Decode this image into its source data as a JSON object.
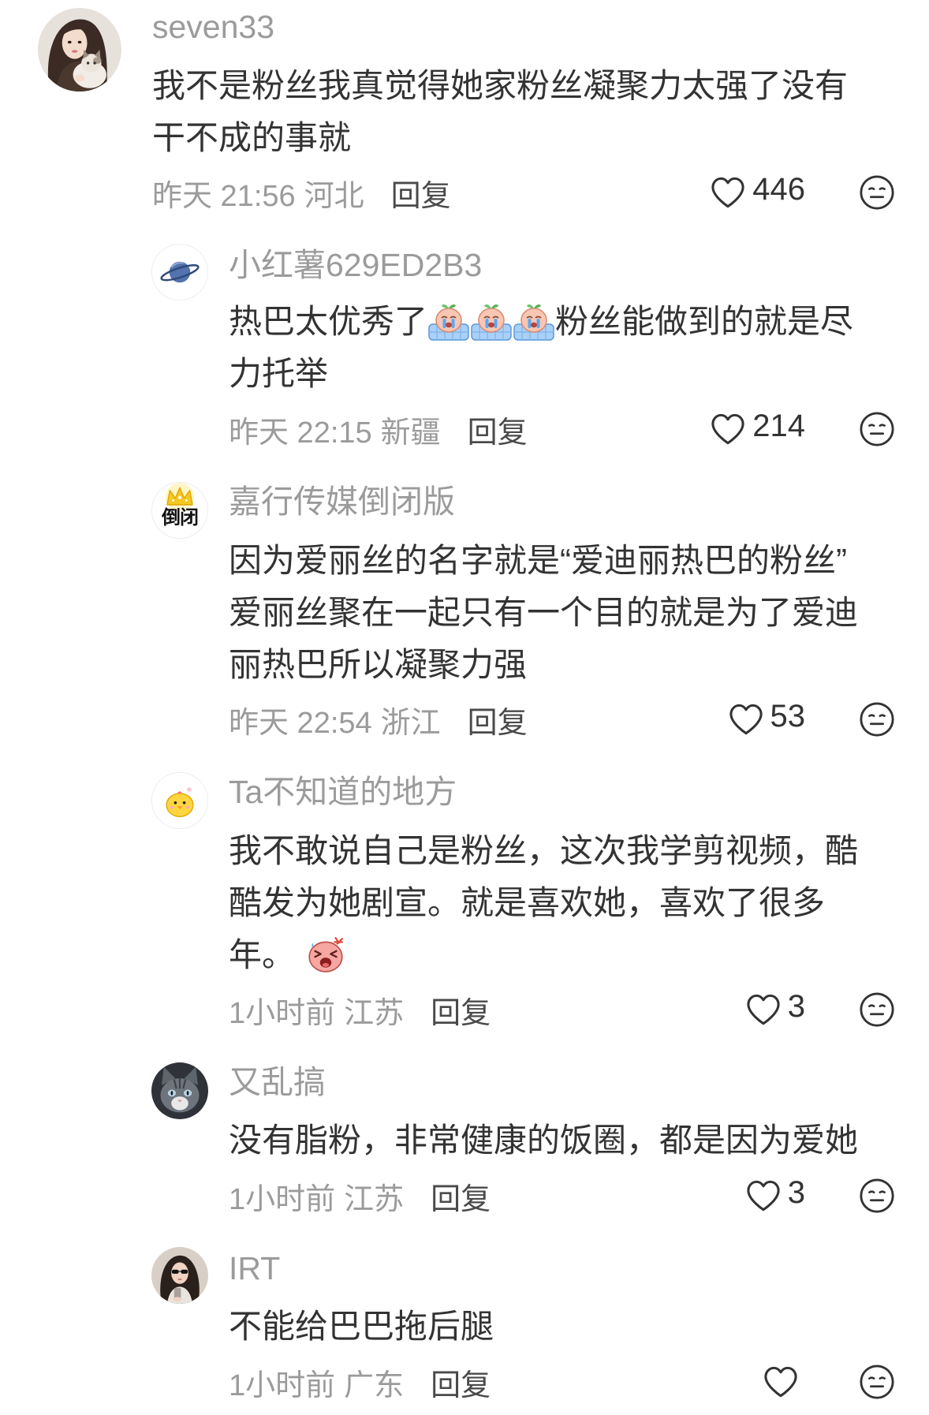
{
  "colors": {
    "background": "#ffffff",
    "text": "#333333",
    "secondary_text": "#9b9b9b",
    "reply_text": "#4a4a4a",
    "icon_stroke": "#333333"
  },
  "icons": {
    "like": "heart-outline-icon",
    "react": "emoji-face-icon",
    "crying_sticker": "crying-sticker-icon",
    "angry_sticker": "angry-sticker-icon"
  },
  "reply_label": "回复",
  "comments": [
    {
      "avatar": "woman-with-cat-avatar",
      "username": "seven33",
      "lines": [
        [
          {
            "text": "我不是粉丝我真觉得她家粉丝凝聚力太强了没有"
          }
        ],
        [
          {
            "text": "干不成的事就"
          }
        ]
      ],
      "time": "昨天 21:56",
      "location": "河北",
      "likes": "446"
    },
    {
      "avatar": "planet-avatar",
      "username": "小红薯629ED2B3",
      "lines": [
        [
          {
            "text": "热巴太优秀了"
          },
          {
            "sticker": "crying-sticker-icon"
          },
          {
            "sticker": "crying-sticker-icon"
          },
          {
            "sticker": "crying-sticker-icon"
          },
          {
            "text": "粉丝能做到的就是尽"
          }
        ],
        [
          {
            "text": "力托举"
          }
        ]
      ],
      "time": "昨天 22:15",
      "location": "新疆",
      "likes": "214"
    },
    {
      "avatar": "gold-crown-avatar",
      "avatar_text": "倒闭",
      "username": "嘉行传媒倒闭版",
      "lines": [
        [
          {
            "text": "因为爱丽丝的名字就是“爱迪丽热巴的粉丝”"
          }
        ],
        [
          {
            "text": "爱丽丝聚在一起只有一个目的就是为了爱迪"
          }
        ],
        [
          {
            "text": "丽热巴所以凝聚力强"
          }
        ]
      ],
      "time": "昨天 22:54",
      "location": "浙江",
      "likes": "53"
    },
    {
      "avatar": "yellow-chick-avatar",
      "username": "Ta不知道的地方",
      "lines": [
        [
          {
            "text": "我不敢说自己是粉丝，这次我学剪视频，酷"
          }
        ],
        [
          {
            "text": "酷发为她剧宣。就是喜欢她，喜欢了很多"
          }
        ],
        [
          {
            "text": "年。"
          },
          {
            "sticker": "angry-sticker-icon"
          }
        ]
      ],
      "time": "1小时前",
      "location": "江苏",
      "likes": "3"
    },
    {
      "avatar": "cat-avatar",
      "username": "又乱搞",
      "lines": [
        [
          {
            "text": "没有脂粉，非常健康的饭圈，都是因为爱她"
          }
        ]
      ],
      "time": "1小时前",
      "location": "江苏",
      "likes": "3"
    },
    {
      "avatar": "woman-avatar",
      "username": "IRT",
      "lines": [
        [
          {
            "text": "不能给巴巴拖后腿"
          }
        ]
      ],
      "time": "1小时前",
      "location": "广东",
      "likes": ""
    }
  ]
}
